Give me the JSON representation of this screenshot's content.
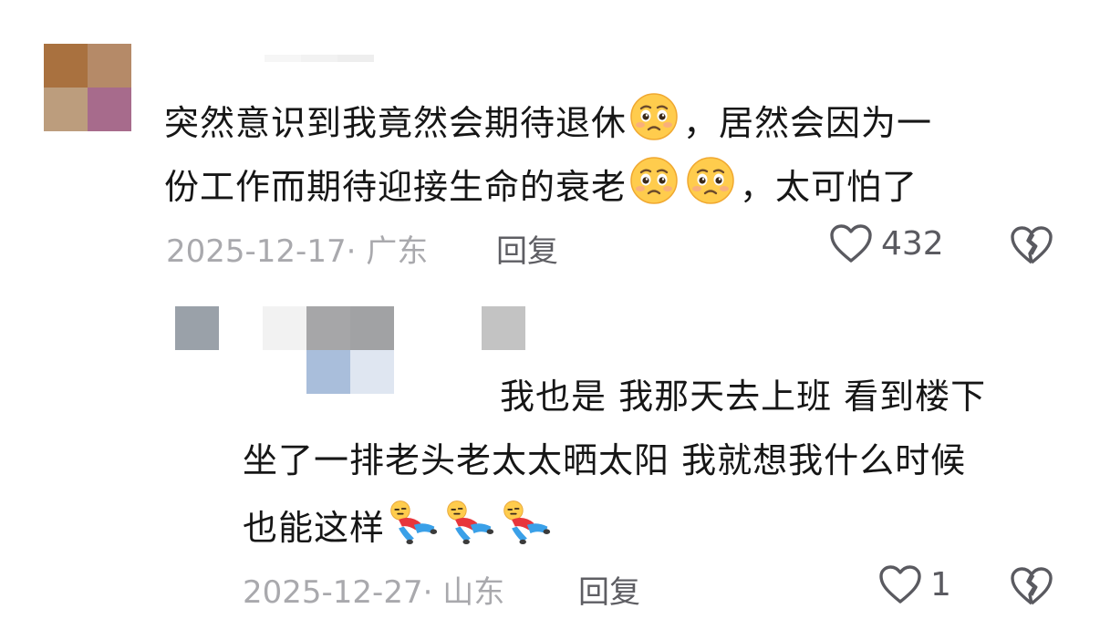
{
  "comments": [
    {
      "avatar_colors": [
        "#a9713f",
        "#b58a68",
        "#bc9d7d",
        "#a76b8c"
      ],
      "name_colors": [
        "#f6f6f6",
        "#f2f2f2",
        "#eeeeee"
      ],
      "text_line1": "突然意识到我竟然会期待退休",
      "text_line1_tail": "，居然会因为一",
      "text_line2": "份工作而期待迎接生命的衰老",
      "text_line2_tail": "，太可怕了",
      "emoji": "pleading-face",
      "date": "2025-12-17· 广东",
      "reply_label": "回复",
      "like_count": "432"
    },
    {
      "name_colors": [
        "#9aa1a9",
        "#ffffff",
        "#f2f2f2",
        "#a6a6a8",
        "#a1a2a4",
        "#ffffff",
        "#ffffff",
        "#c3c3c3",
        "#ffffff",
        "#ffffff",
        "#ffffff",
        "#a9bedb",
        "#dfe6f1",
        "#ffffff",
        "#ffffff",
        "#ffffff"
      ],
      "text_line1": "我也是 我那天去上班 看到楼下",
      "text_line2": "坐了一排老头老太太晒太阳 我就想我什么时候",
      "text_line3": "也能这样",
      "emoji": "lying-down-relax",
      "date": "2025-12-27· 山东",
      "reply_label": "回复",
      "like_count": "1"
    }
  ],
  "colors": {
    "text": "#161616",
    "meta": "#a9a9ad",
    "action": "#5e5e63",
    "emoji_face": "#ffcc4d"
  }
}
